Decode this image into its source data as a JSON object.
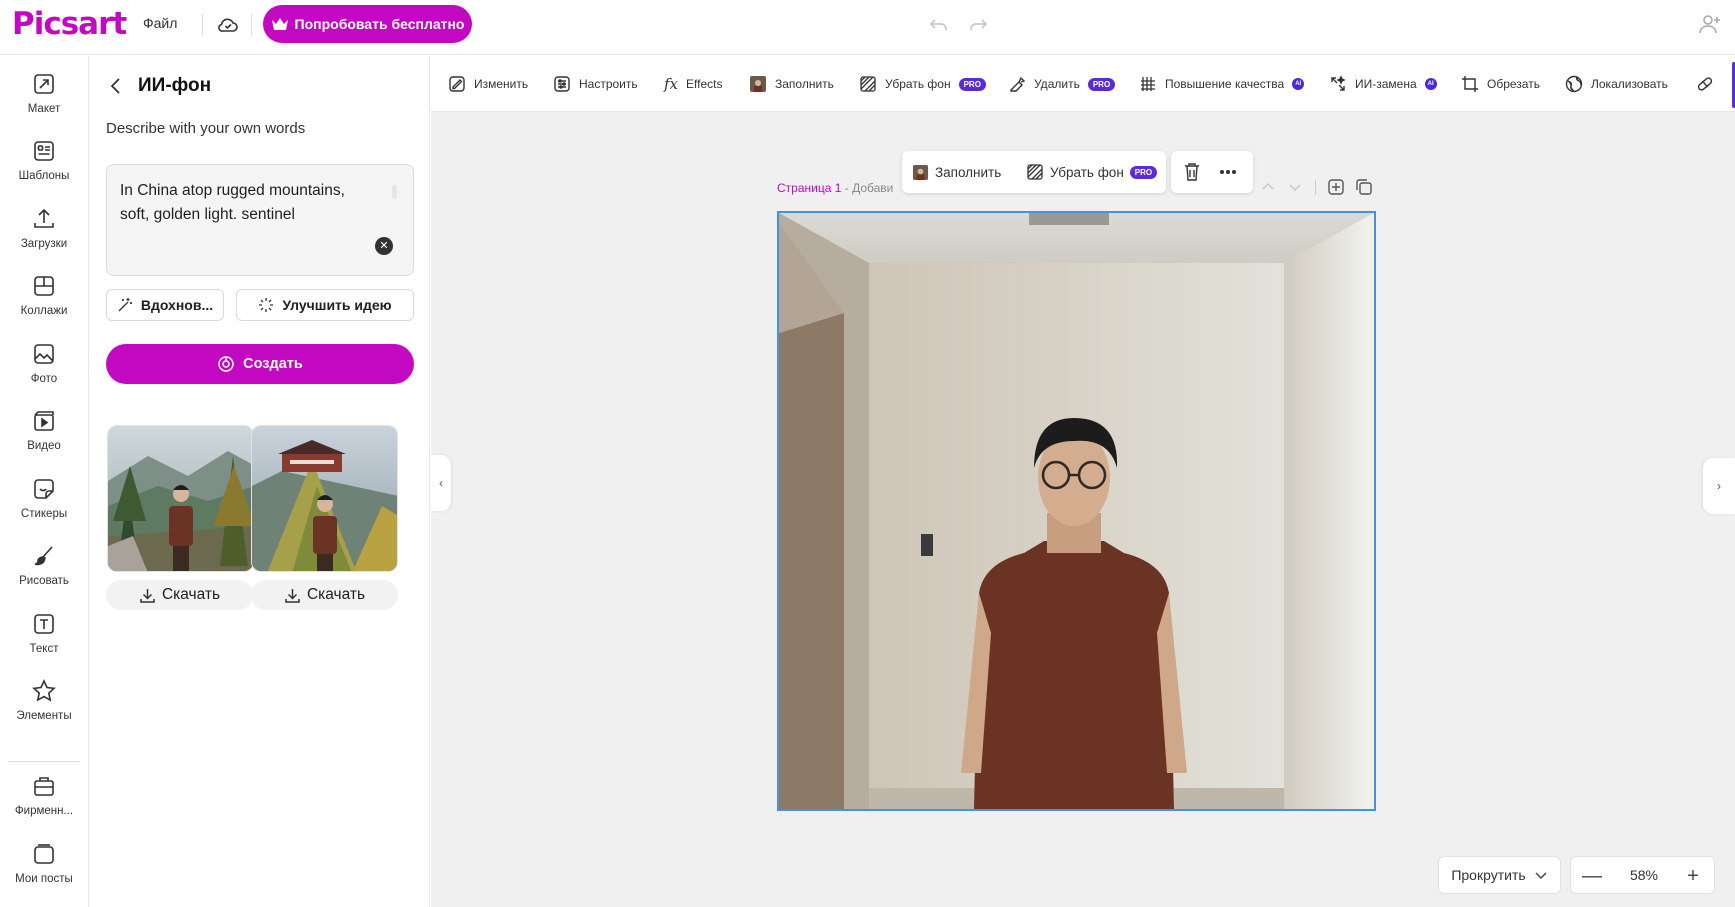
{
  "header": {
    "logo": "Picsart",
    "file_menu": "Файл",
    "try_free": "Попробовать бесплатно"
  },
  "rail": {
    "items": [
      {
        "label": "Макет",
        "icon": "layout-icon"
      },
      {
        "label": "Шаблоны",
        "icon": "templates-icon"
      },
      {
        "label": "Загрузки",
        "icon": "upload-icon"
      },
      {
        "label": "Коллажи",
        "icon": "collage-icon"
      },
      {
        "label": "Фото",
        "icon": "photo-icon"
      },
      {
        "label": "Видео",
        "icon": "video-icon"
      },
      {
        "label": "Стикеры",
        "icon": "sticker-icon"
      },
      {
        "label": "Рисовать",
        "icon": "brush-icon"
      },
      {
        "label": "Текст",
        "icon": "text-icon"
      },
      {
        "label": "Элементы",
        "icon": "star-icon"
      },
      {
        "label": "Фирменн...",
        "icon": "brand-kit-icon"
      },
      {
        "label": "Мои посты",
        "icon": "my-posts-icon"
      }
    ]
  },
  "panel": {
    "title": "ИИ-фон",
    "subtitle": "Describe with your own words",
    "prompt_value": "In China atop rugged mountains, soft, golden light. sentinel",
    "inspire_label": "Вдохнов...",
    "improve_label": "Улучшить идею",
    "create_label": "Создать",
    "download_label": "Скачать"
  },
  "toolbar": {
    "edit": "Изменить",
    "adjust": "Настроить",
    "effects": "Effects",
    "fill": "Заполнить",
    "remove_bg": "Убрать фон",
    "remove": "Удалить",
    "enhance": "Повышение качества",
    "ai_replace": "ИИ-замена",
    "crop": "Обрезать",
    "localize": "Локализовать",
    "pro_badge": "PRO",
    "ai_badge": "AI"
  },
  "floating": {
    "fill": "Заполнить",
    "remove_bg": "Убрать фон",
    "pro_badge": "PRO"
  },
  "page": {
    "number": "Страница 1",
    "add_title": " - Добави"
  },
  "canvas_controls": {
    "scroll_mode": "Прокрутить",
    "zoom": "58%",
    "zoom_minus": "—",
    "zoom_plus": "+"
  },
  "colors": {
    "brand": "#c209c1",
    "pro": "#5b2bd8",
    "selection": "#4a90e2"
  }
}
